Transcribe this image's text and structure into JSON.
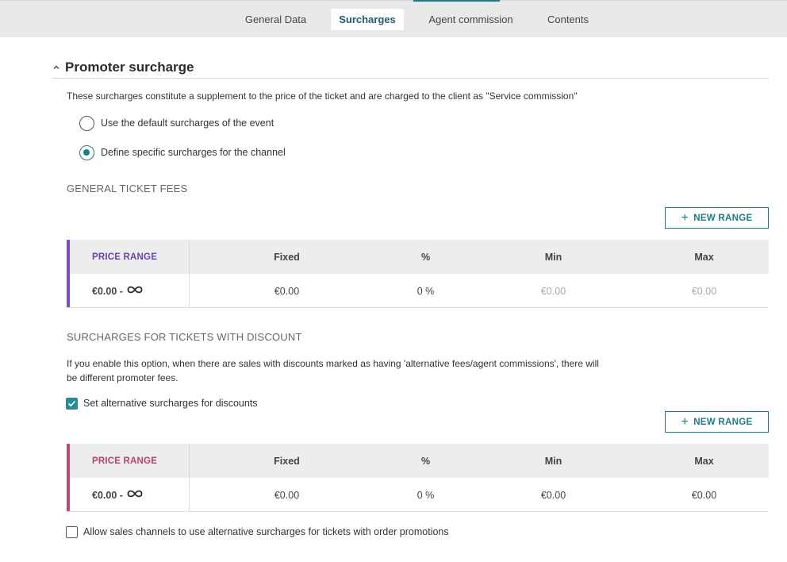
{
  "tabs": [
    {
      "label": "General Data",
      "active": false
    },
    {
      "label": "Surcharges",
      "active": true
    },
    {
      "label": "Agent commission",
      "active": false
    },
    {
      "label": "Contents",
      "active": false
    }
  ],
  "section": {
    "title": "Promoter surcharge",
    "expanded": true,
    "description": "These surcharges constitute a supplement to the price of the ticket and are charged to the client as \"Service commission\""
  },
  "radio_options": [
    {
      "label": "Use the default surcharges of the event",
      "checked": false
    },
    {
      "label": "Define specific surcharges for the channel",
      "checked": true
    }
  ],
  "general_fees": {
    "heading": "GENERAL TICKET FEES",
    "new_range_label": "NEW RANGE",
    "accent_color": "#7b4fc2",
    "range_header_color": "#6a3fb5",
    "columns": [
      "PRICE RANGE",
      "Fixed",
      "%",
      "Min",
      "Max"
    ],
    "rows": [
      {
        "range": "€0.00 -",
        "fixed": "€0.00",
        "pct": "0 %",
        "min": "€0.00",
        "max": "€0.00"
      }
    ]
  },
  "discount_fees": {
    "heading": "SURCHARGES FOR TICKETS WITH DISCOUNT",
    "description": "If you enable this option, when there are sales with discounts marked as having 'alternative fees/agent commissions', there will be different promoter fees.",
    "checkbox_label": "Set alternative surcharges for discounts",
    "checkbox_checked": true,
    "new_range_label": "NEW RANGE",
    "accent_color": "#c2487a",
    "range_header_color": "#b8406e",
    "columns": [
      "PRICE RANGE",
      "Fixed",
      "%",
      "Min",
      "Max"
    ],
    "rows": [
      {
        "range": "€0.00 -",
        "fixed": "€0.00",
        "pct": "0 %",
        "min": "€0.00",
        "max": "€0.00"
      }
    ]
  },
  "order_promotions": {
    "checkbox_label": "Allow sales channels to use alternative surcharges for tickets with order promotions",
    "checked": false
  },
  "colors": {
    "accent": "#1e7b86",
    "tabbar_bg": "#e9e9e9"
  }
}
